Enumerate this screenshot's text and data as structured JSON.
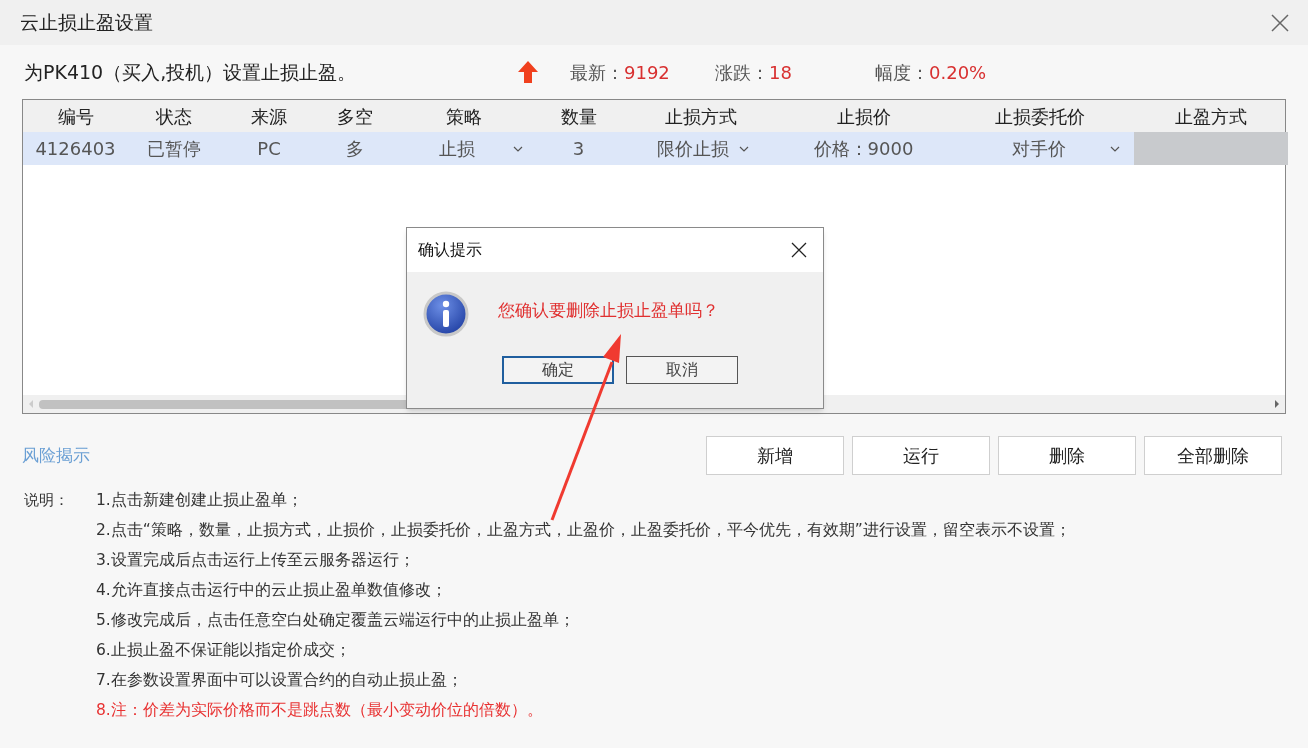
{
  "window": {
    "title": "云止损止盈设置"
  },
  "header": {
    "text": "为PK410（买入,投机）设置止损止盈。",
    "stats": [
      {
        "label": "最新：",
        "value": "9192"
      },
      {
        "label": "涨跌：",
        "value": "18"
      },
      {
        "label": "幅度：",
        "value": "0.20%"
      }
    ]
  },
  "table": {
    "columns": [
      "编号",
      "状态",
      "来源",
      "多空",
      "策略",
      "数量",
      "止损方式",
      "止损价",
      "止损委托价",
      "止盈方式"
    ],
    "rows": [
      {
        "selected": true,
        "cells": [
          {
            "kind": "text",
            "text": "4126403"
          },
          {
            "kind": "text",
            "text": "已暂停"
          },
          {
            "kind": "text",
            "text": "PC"
          },
          {
            "kind": "text",
            "text": "多"
          },
          {
            "kind": "dropdown",
            "text": "止损"
          },
          {
            "kind": "text",
            "text": "3"
          },
          {
            "kind": "dropdown",
            "text": "限价止损"
          },
          {
            "kind": "text",
            "text": "价格：9000"
          },
          {
            "kind": "dropdown",
            "text": "对手价"
          },
          {
            "kind": "empty"
          }
        ]
      }
    ]
  },
  "risk_link": "风险揭示",
  "buttons": [
    "新增",
    "运行",
    "删除",
    "全部删除"
  ],
  "notes": {
    "label": "说明：",
    "items": [
      {
        "text": "1.点击新建创建止损止盈单；",
        "warning": false
      },
      {
        "text": "2.点击“策略，数量，止损方式，止损价，止损委托价，止盈方式，止盈价，止盈委托价，平今优先，有效期”进行设置，留空表示不设置；",
        "warning": false
      },
      {
        "text": "3.设置完成后点击运行上传至云服务器运行；",
        "warning": false
      },
      {
        "text": "4.允许直接点击运行中的云止损止盈单数值修改；",
        "warning": false
      },
      {
        "text": "5.修改完成后，点击任意空白处确定覆盖云端运行中的止损止盈单；",
        "warning": false
      },
      {
        "text": "6.止损止盈不保证能以指定价成交；",
        "warning": false
      },
      {
        "text": "7.在参数设置界面中可以设置合约的自动止损止盈；",
        "warning": false
      },
      {
        "text": "8.注：价差为实际价格而不是跳点数（最小变动价位的倍数）。",
        "warning": true
      }
    ]
  },
  "dialog": {
    "title": "确认提示",
    "message": "您确认要删除止损止盈单吗？",
    "buttons": [
      {
        "label": "确定",
        "default": true
      },
      {
        "label": "取消",
        "default": false
      }
    ]
  }
}
